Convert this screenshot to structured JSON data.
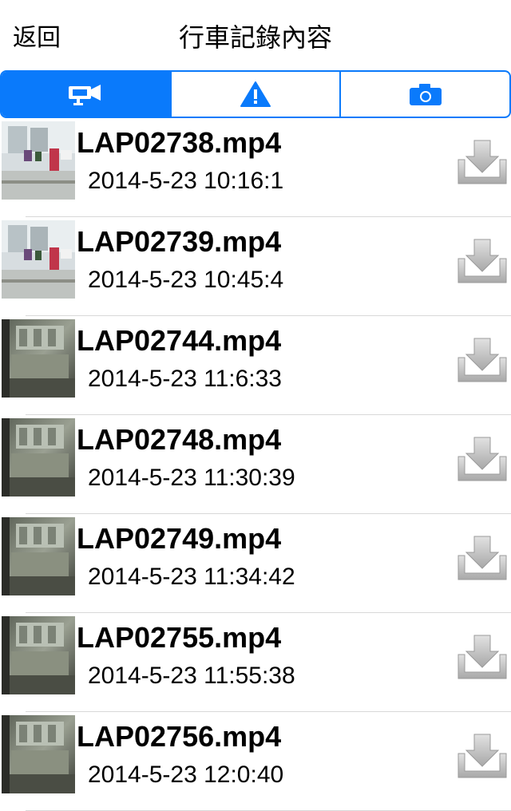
{
  "nav": {
    "back_label": "返回",
    "title": "行車記錄內容"
  },
  "tabs": [
    {
      "icon": "video-camera-icon",
      "active": true
    },
    {
      "icon": "warning-icon",
      "active": false
    },
    {
      "icon": "camera-icon",
      "active": false
    }
  ],
  "colors": {
    "accent": "#0a7afb",
    "separator": "#d8d8d8"
  },
  "files": [
    {
      "name": "LAP02738.mp4",
      "date": "2014-5-23 10:16:1"
    },
    {
      "name": "LAP02739.mp4",
      "date": "2014-5-23 10:45:4"
    },
    {
      "name": "LAP02744.mp4",
      "date": "2014-5-23 11:6:33"
    },
    {
      "name": "LAP02748.mp4",
      "date": "2014-5-23 11:30:39"
    },
    {
      "name": "LAP02749.mp4",
      "date": "2014-5-23 11:34:42"
    },
    {
      "name": "LAP02755.mp4",
      "date": "2014-5-23 11:55:38"
    },
    {
      "name": "LAP02756.mp4",
      "date": "2014-5-23 12:0:40"
    }
  ]
}
